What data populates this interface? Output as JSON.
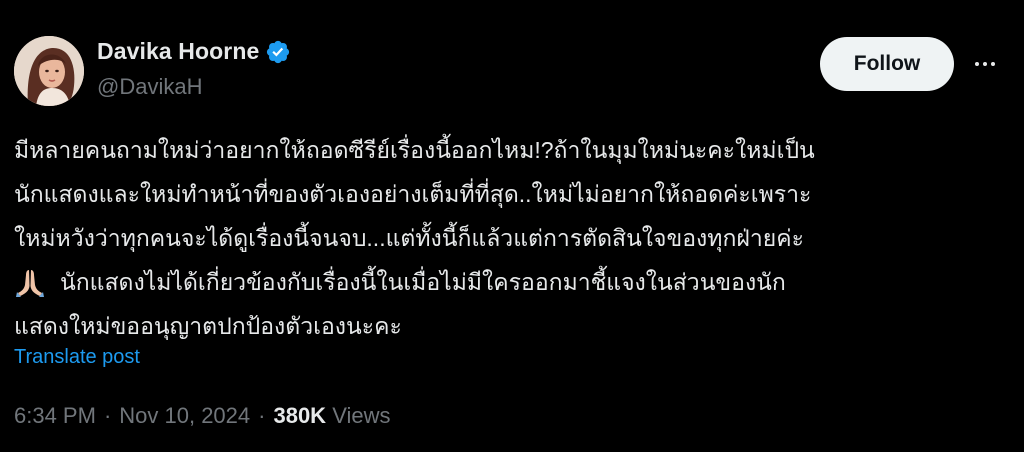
{
  "author": {
    "display_name": "Davika Hoorne",
    "handle": "@DavikaH",
    "verified_icon": "verified-badge-icon",
    "avatar_icon": "avatar-photo"
  },
  "actions": {
    "follow_label": "Follow",
    "more_icon": "more-icon"
  },
  "post": {
    "lines": [
      "มีหลายคนถามใหม่ว่าอยากให้ถอดซีรีย์เรื่องนี้ออกไหม!?ถ้าในมุมใหม่นะคะใหม่เป็น",
      "นักแสดงและใหม่ทำหน้าที่ของตัวเองอย่างเต็มที่ที่สุด..ใหม่ไม่อยากให้ถอดค่ะเพราะ",
      "ใหม่หวังว่าทุกคนจะได้ดูเรื่องนี้จนจบ...แต่ทั้งนี้ก็แล้วแต่การตัดสินใจของทุกฝ่ายค่ะ",
      "นักแสดงไม่ได้เกี่ยวข้องกับเรื่องนี้ในเมื่อไม่มีใครออกมาชี้แจงในส่วนของนัก",
      "แสดงใหม่ขออนุญาตปกป้องตัวเองนะคะ"
    ],
    "emoji_icon": "folded-hands-icon",
    "translate_label": "Translate post"
  },
  "meta": {
    "time": "6:34 PM",
    "separator": "·",
    "date": "Nov 10, 2024",
    "views_count": "380K",
    "views_label": "Views"
  },
  "colors": {
    "background": "#000000",
    "text": "#e7e9ea",
    "secondary": "#71767b",
    "accent": "#1d9bf0",
    "follow_bg": "#eff3f4"
  }
}
